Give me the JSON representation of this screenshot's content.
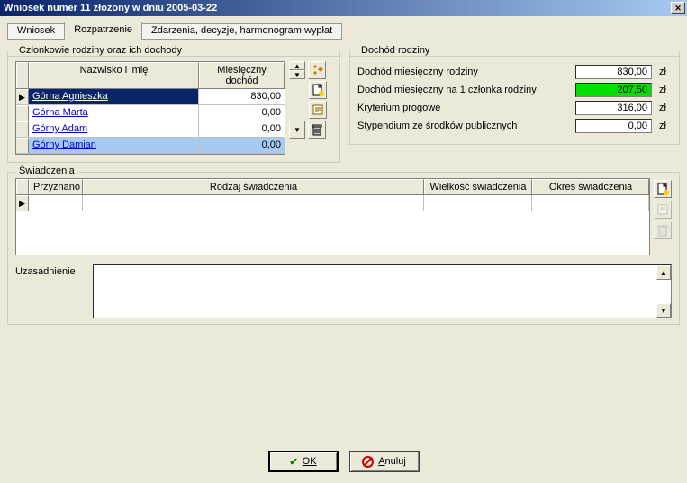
{
  "window": {
    "title": "Wniosek numer 11 złożony w dniu 2005-03-22"
  },
  "tabs": {
    "wniosek": "Wniosek",
    "rozpatrzenie": "Rozpatrzenie",
    "zdarzenia": "Zdarzenia, decyzje, harmonogram wypłat"
  },
  "members": {
    "legend": "Członkowie rodziny oraz ich dochody",
    "headers": {
      "name": "Nazwisko i imię",
      "income": "Miesięczny dochód"
    },
    "rows": [
      {
        "name": "Górna Agnieszka",
        "income": "830,00",
        "current": true
      },
      {
        "name": "Górna Marta",
        "income": "0,00"
      },
      {
        "name": "Górny Adam",
        "income": "0,00"
      },
      {
        "name": "Górny Damian",
        "income": "0,00",
        "highlight": true
      }
    ],
    "icons": {
      "sparkle": "sparkle-icon",
      "page": "page-icon",
      "scroll": "scroll-icon",
      "trash": "trash-icon"
    }
  },
  "income": {
    "legend": "Dochód rodziny",
    "rows": [
      {
        "label": "Dochód miesięczny rodziny",
        "value": "830,00",
        "unit": "zł"
      },
      {
        "label": "Dochód miesięczny na 1 członka rodziny",
        "value": "207,50",
        "unit": "zł",
        "green": true
      },
      {
        "label": "Kryterium progowe",
        "value": "316,00",
        "unit": "zł"
      },
      {
        "label": "Stypendium ze środków publicznych",
        "value": "0,00",
        "unit": "zł"
      }
    ]
  },
  "swiadczenia": {
    "legend": "Świadczenia",
    "headers": {
      "przyznano": "Przyznano",
      "rodzaj": "Rodzaj świadczenia",
      "wielkosc": "Wielkość świadczenia",
      "okres": "Okres świadczenia"
    },
    "uzasadnienie_label": "Uzasadnienie",
    "icons": {
      "new": "new-page-icon",
      "scroll": "scroll-icon",
      "trash": "trash-icon"
    }
  },
  "buttons": {
    "ok": "OK",
    "cancel": "Anuluj"
  }
}
